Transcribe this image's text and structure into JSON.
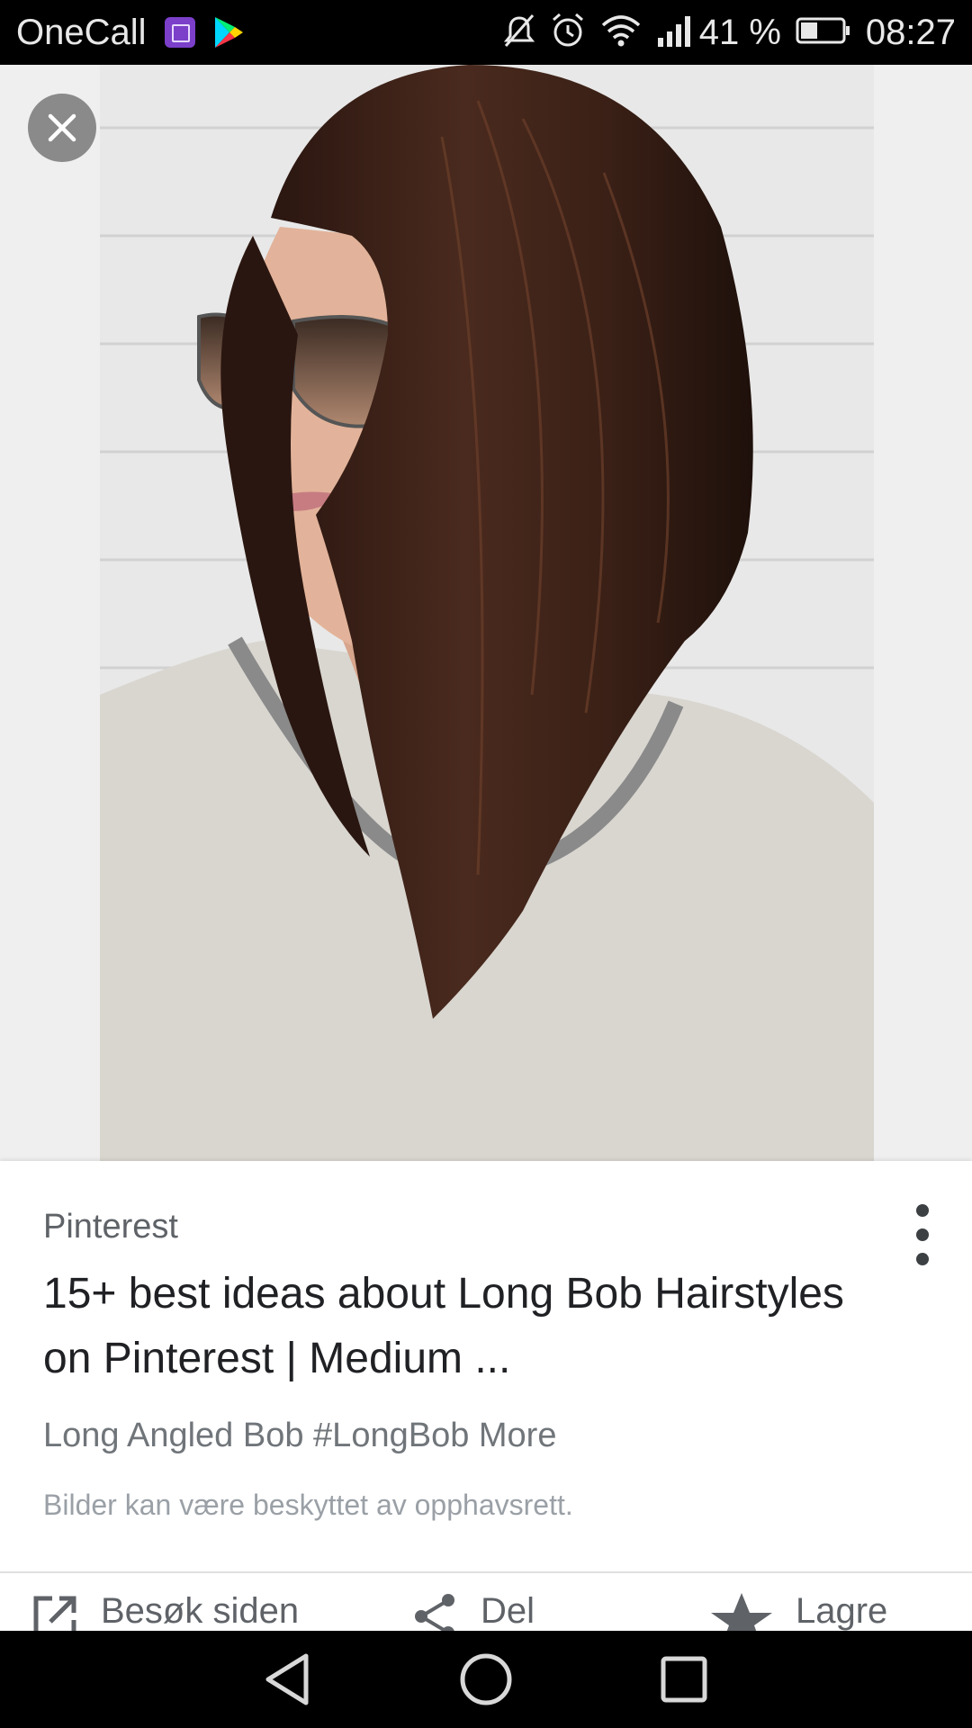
{
  "status_bar": {
    "carrier": "OneCall",
    "battery_percent": "41 %",
    "time": "08:27",
    "icons": [
      "gallery-app-icon",
      "play-store-icon",
      "mute-icon",
      "alarm-icon",
      "wifi-icon",
      "signal-icon",
      "battery-icon"
    ]
  },
  "result": {
    "source": "Pinterest",
    "title": "15+ best ideas about Long Bob Hairstyles on Pinterest | Medium ...",
    "description": "Long Angled Bob #LongBob More",
    "copyright_notice": "Bilder kan være beskyttet av opphavsrett."
  },
  "actions": [
    {
      "label": "Besøk siden",
      "icon": "open-external-icon"
    },
    {
      "label": "Del",
      "icon": "share-icon"
    },
    {
      "label": "Lagre",
      "icon": "star-icon"
    }
  ],
  "nav_bar": {
    "icons": [
      "back-icon",
      "home-icon",
      "recents-icon"
    ]
  },
  "colors": {
    "status_bar_bg": "#000000",
    "page_bg": "#efefef",
    "card_bg": "#ffffff",
    "title_text": "#202124",
    "secondary_text": "#5f6368"
  }
}
